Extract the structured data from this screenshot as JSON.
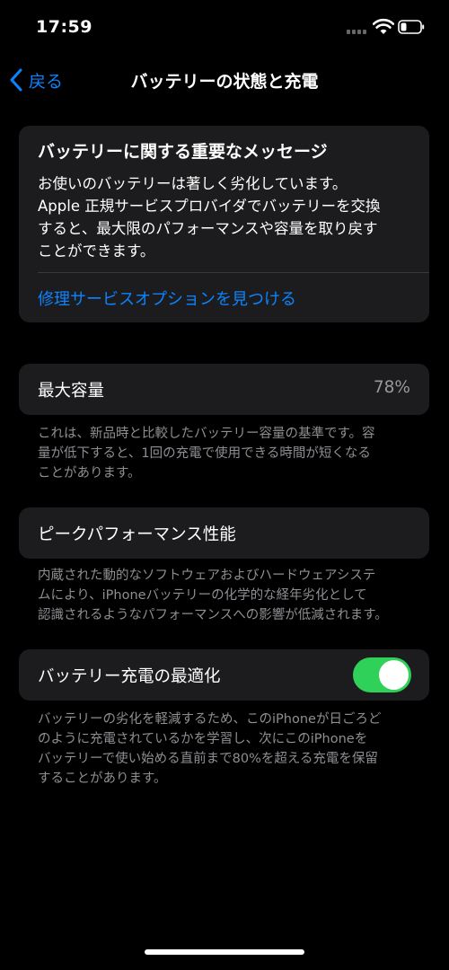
{
  "status_bar": {
    "time": "17:59",
    "icons": [
      "signal-icon",
      "wifi-icon",
      "battery-icon"
    ]
  },
  "nav": {
    "back_label": "戻る",
    "title": "バッテリーの状態と充電"
  },
  "message": {
    "title": "バッテリーに関する重要なメッセージ",
    "body_lines": [
      "お使いのバッテリーは著しく劣化しています。",
      "Apple 正規サービスプロバイダでバッテリーを交換",
      "すると、最大限のパフォーマンスや容量を取り戻す",
      "ことができます。"
    ],
    "link": "修理サービスオプションを見つける"
  },
  "max_capacity": {
    "label": "最大容量",
    "value": "78%",
    "footnote_lines": [
      "これは、新品時と比較したバッテリー容量の基準です。容",
      "量が低下すると、1回の充電で使用できる時間が短くなる",
      "ことがあります。"
    ]
  },
  "peak_performance": {
    "label": "ピークパフォーマンス性能",
    "footnote_lines": [
      "内蔵された動的なソフトウェアおよびハードウェアシステ",
      "ムにより、iPhoneバッテリーの化学的な経年劣化として",
      "認識されるようなパフォーマンスへの影響が低減されます。"
    ]
  },
  "optimized_charging": {
    "label": "バッテリー充電の最適化",
    "enabled": true,
    "footnote_lines": [
      "バッテリーの劣化を軽減するため、このiPhoneが日ごろど",
      "のように充電されているかを学習し、次にこのiPhoneを",
      "バッテリーで使い始める直前まで80%を超える充電を保留",
      "することがあります。"
    ]
  },
  "colors": {
    "background": "#000000",
    "card": "#1c1c1e",
    "accent": "#0a84ff",
    "toggle_on": "#30d158",
    "secondary_text": "#8e8e93"
  }
}
